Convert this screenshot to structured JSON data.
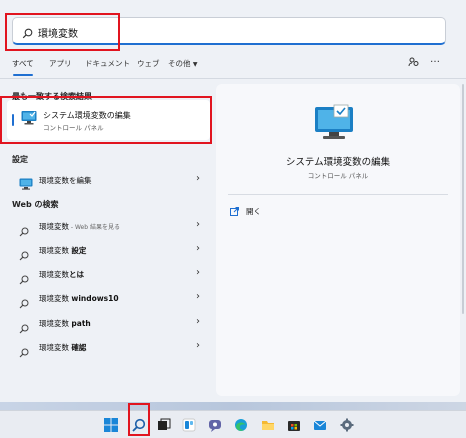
{
  "search": {
    "query": "環境変数"
  },
  "tabs": [
    {
      "label": "すべて",
      "active": true
    },
    {
      "label": "アプリ"
    },
    {
      "label": "ドキュメント"
    },
    {
      "label": "ウェブ"
    },
    {
      "label": "その他"
    }
  ],
  "top_right": {
    "more": "…"
  },
  "sections": {
    "best": "最も一致する検索結果",
    "settings": "設定",
    "web": "Web の検索"
  },
  "best_match": {
    "title": "システム環境変数の編集",
    "subtitle": "コントロール パネル"
  },
  "settings_items": [
    {
      "label": "環境変数を編集"
    }
  ],
  "web_items": [
    {
      "label": "環境変数",
      "suffix": " - Web 結果を見る"
    },
    {
      "label": "環境変数",
      "bold": "設定"
    },
    {
      "label": "環境変数",
      "bold": "とは"
    },
    {
      "label": "環境変数",
      "bold": "windows10"
    },
    {
      "label": "環境変数",
      "bold": "path"
    },
    {
      "label": "環境変数",
      "bold": "確認"
    }
  ],
  "detail": {
    "title": "システム環境変数の編集",
    "subtitle": "コントロール パネル",
    "open_label": "開く"
  },
  "colors": {
    "accent": "#1f6fd1",
    "highlight": "#e1141f"
  },
  "taskbar_icons": [
    "windows-start-icon",
    "search-icon",
    "task-view-icon",
    "widgets-icon",
    "teams-chat-icon",
    "edge-icon",
    "file-explorer-icon",
    "store-icon",
    "mail-icon",
    "settings-icon"
  ]
}
